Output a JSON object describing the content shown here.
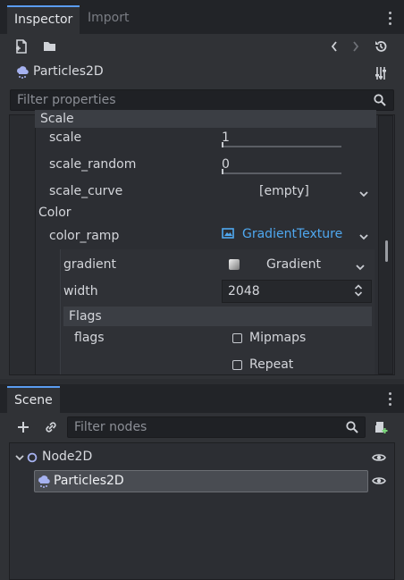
{
  "inspector": {
    "tabs": [
      {
        "label": "Inspector"
      },
      {
        "label": "Import"
      }
    ],
    "object_name": "Particles2D",
    "filter_placeholder": "Filter properties",
    "sections": {
      "scale": "Scale",
      "color": "Color",
      "flags": "Flags"
    },
    "properties": {
      "scale": {
        "label": "scale",
        "value": "1"
      },
      "scale_random": {
        "label": "scale_random",
        "value": "0"
      },
      "scale_curve": {
        "label": "scale_curve",
        "value": "[empty]"
      },
      "color_ramp": {
        "label": "color_ramp",
        "value": "GradientTexture"
      },
      "gradient": {
        "label": "gradient",
        "value": "Gradient"
      },
      "width": {
        "label": "width",
        "value": "2048"
      },
      "flags": {
        "label": "flags",
        "options": [
          {
            "label": "Mipmaps",
            "checked": false
          },
          {
            "label": "Repeat",
            "checked": false
          }
        ]
      }
    }
  },
  "scene": {
    "tab": "Scene",
    "filter_placeholder": "Filter nodes",
    "nodes": [
      {
        "name": "Node2D",
        "icon": "node2d-icon",
        "visible": true
      },
      {
        "name": "Particles2D",
        "icon": "particles2d-icon",
        "visible": true,
        "selected": true
      }
    ]
  },
  "colors": {
    "accent": "#5a9cf0",
    "link": "#4fa8f0",
    "background": "#2b2d31",
    "panel": "#303236"
  }
}
